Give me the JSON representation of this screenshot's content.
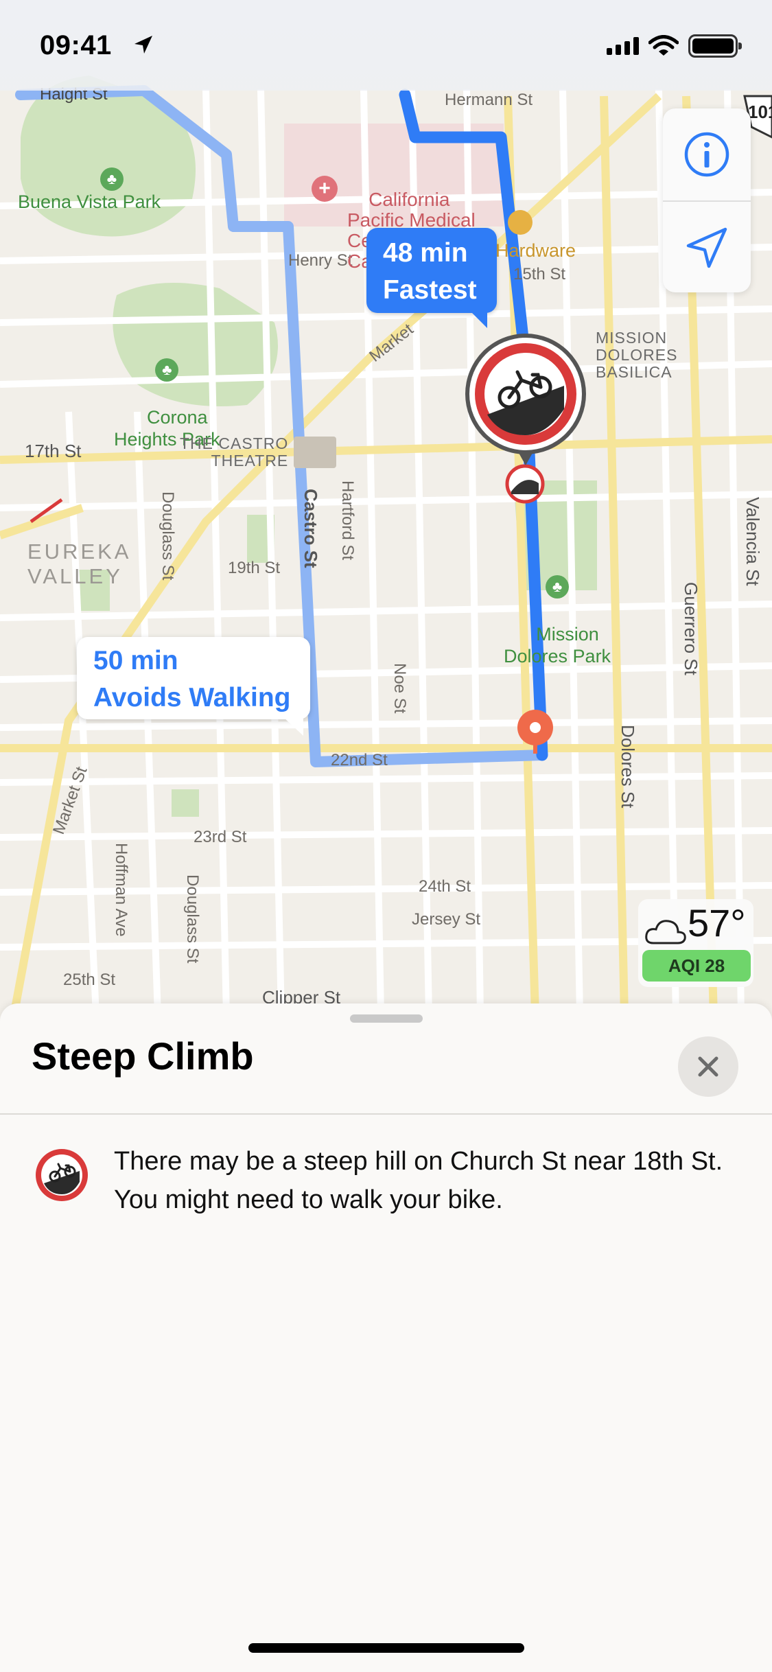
{
  "status_bar": {
    "time": "09:41"
  },
  "map": {
    "streets": {
      "haight": "Haight St",
      "hermann": "Hermann St",
      "henry": "Henry St",
      "market_upper": "Market",
      "fifteenth": "15th St",
      "seventeenth": "17th St",
      "nineteenth": "19th St",
      "castro": "Castro St",
      "hartford": "Hartford St",
      "douglass_upper": "Douglass St",
      "noe": "Noe St",
      "twenty_second": "22nd St",
      "market_lower": "Market St",
      "twenty_third": "23rd St",
      "hoffman": "Hoffman Ave",
      "douglass_lower": "Douglass St",
      "twenty_fourth": "24th St",
      "jersey": "Jersey St",
      "twenty_fifth": "25th St",
      "clipper": "Clipper St",
      "dolores": "Dolores St",
      "guerrero": "Guerrero St",
      "valencia": "Valencia St",
      "highway": "101"
    },
    "places": {
      "buena_vista": "Buena Vista Park",
      "cpmc": "California\nPacific Medical\nCenter - Davies\nCampus",
      "hardware": "Hardware",
      "corona": "Corona\nHeights Park",
      "mission_dolores_basilica": "MISSION\nDOLORES\nBASILICA",
      "castro_theatre": "THE CASTRO\nTHEATRE",
      "eureka": "EUREKA\nVALLEY",
      "mission_dolores_park": "Mission\nDolores Park"
    },
    "route_fastest": {
      "duration": "48 min",
      "label": "Fastest"
    },
    "route_alt": {
      "duration": "50 min",
      "label": "Avoids Walking"
    },
    "weather": {
      "temperature": "57°",
      "aqi": "AQI 28"
    },
    "colors": {
      "route": "#2f7cf6",
      "route_alt": "#8db4f4",
      "steep": "#d93a3a"
    }
  },
  "sheet": {
    "title": "Steep Climb",
    "description": "There may be a steep hill on Church St near 18th St. You might need to walk your bike."
  },
  "icons": {
    "info": "info-icon",
    "location": "location-arrow-icon",
    "close": "close-icon",
    "steep": "steep-climb-bike-icon"
  }
}
